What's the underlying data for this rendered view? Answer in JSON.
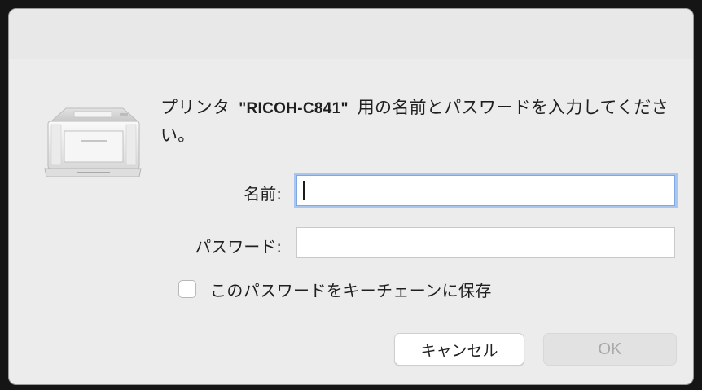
{
  "dialog": {
    "message_prefix": "プリンタ ",
    "printer_name": "\"RICOH-C841\"",
    "message_suffix": " 用の名前とパスワードを入力してください。",
    "icon": "printer-icon"
  },
  "form": {
    "name_label": "名前:",
    "name_value": "",
    "password_label": "パスワード:",
    "password_value": "",
    "keychain_label": "このパスワードをキーチェーンに保存",
    "keychain_checked": false
  },
  "buttons": {
    "cancel_label": "キャンセル",
    "ok_label": "OK"
  }
}
